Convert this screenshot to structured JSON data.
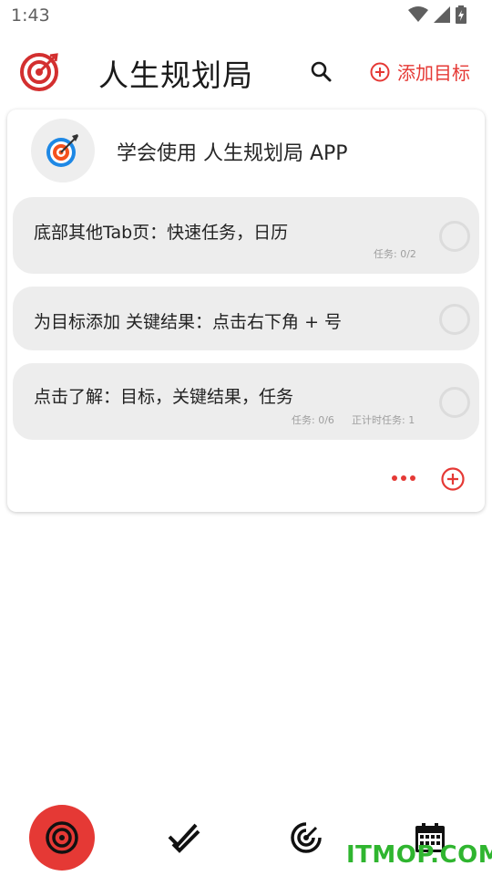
{
  "status_bar": {
    "time": "1:43"
  },
  "app_bar": {
    "title": "人生规划局",
    "add_goal_label": "添加目标",
    "accent_color": "#e53935"
  },
  "goal": {
    "title": "学会使用 人生规划局 APP",
    "key_results": [
      {
        "title": "底部其他Tab页：快速任务，日历",
        "tasks": "任务: 0/2",
        "timer_tasks": ""
      },
      {
        "title": "为目标添加 关键结果：点击右下角 + 号",
        "tasks": "",
        "timer_tasks": ""
      },
      {
        "title": "点击了解：目标，关键结果，任务",
        "tasks": "任务: 0/6",
        "timer_tasks": "正计时任务: 1"
      }
    ]
  },
  "bottom_nav": {
    "items": [
      {
        "icon": "target-icon",
        "active": true
      },
      {
        "icon": "double-check-icon",
        "active": false
      },
      {
        "icon": "radar-icon",
        "active": false
      },
      {
        "icon": "calendar-icon",
        "active": false
      }
    ]
  },
  "watermark": "ITMOP.COM"
}
